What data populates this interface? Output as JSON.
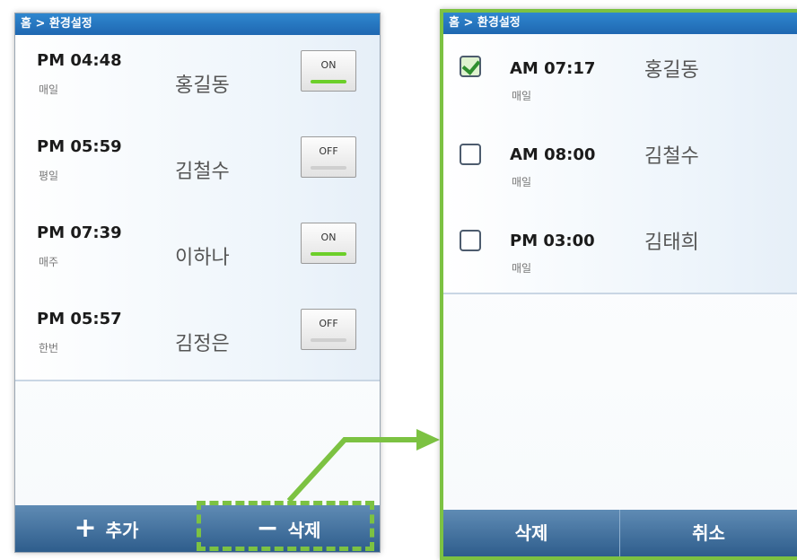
{
  "left": {
    "breadcrumb": "홈 > 환경설정",
    "alarms": [
      {
        "time": "PM 04:48",
        "freq": "매일",
        "name": "홍길동",
        "toggle": "ON"
      },
      {
        "time": "PM 05:59",
        "freq": "평일",
        "name": "김철수",
        "toggle": "OFF"
      },
      {
        "time": "PM 07:39",
        "freq": "매주",
        "name": "이하나",
        "toggle": "ON"
      },
      {
        "time": "PM 05:57",
        "freq": "한번",
        "name": "김정은",
        "toggle": "OFF"
      }
    ],
    "bottom": {
      "add_icon": "+",
      "add_label": "추가",
      "delete_icon": "−",
      "delete_label": "삭제"
    }
  },
  "right": {
    "breadcrumb": "홈 > 환경설정",
    "alarms": [
      {
        "time": "AM 07:17",
        "freq": "매일",
        "name": "홍길동",
        "checked": true
      },
      {
        "time": "AM 08:00",
        "freq": "매일",
        "name": "김철수",
        "checked": false
      },
      {
        "time": "PM 03:00",
        "freq": "매일",
        "name": "김태희",
        "checked": false
      }
    ],
    "bottom": {
      "delete_label": "삭제",
      "cancel_label": "취소"
    }
  },
  "colors": {
    "highlight": "#7cc242",
    "header_blue": "#1f67b1",
    "toggle_on": "#6ccf2a"
  },
  "icons": [
    "plus-icon",
    "minus-icon",
    "checkmark-icon",
    "arrow-icon"
  ]
}
